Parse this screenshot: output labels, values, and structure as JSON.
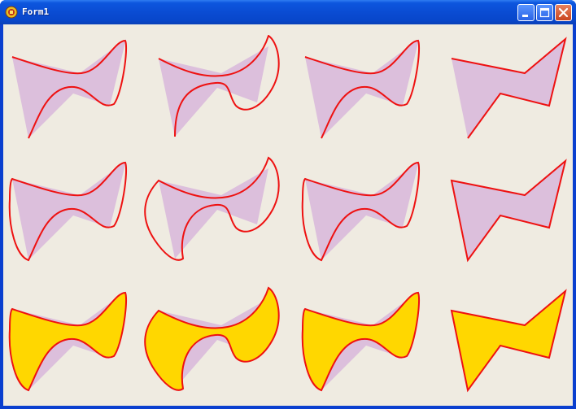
{
  "window": {
    "title": "Form1"
  },
  "titlebar_buttons": {
    "minimize": "minimize-icon",
    "maximize": "maximize-icon",
    "close": "close-icon"
  },
  "colors": {
    "client_bg": "#efebe1",
    "polygon_fill": "#dcbfdc",
    "curve_stroke": "#ee1111",
    "curve_fill": "#ffd700"
  }
}
